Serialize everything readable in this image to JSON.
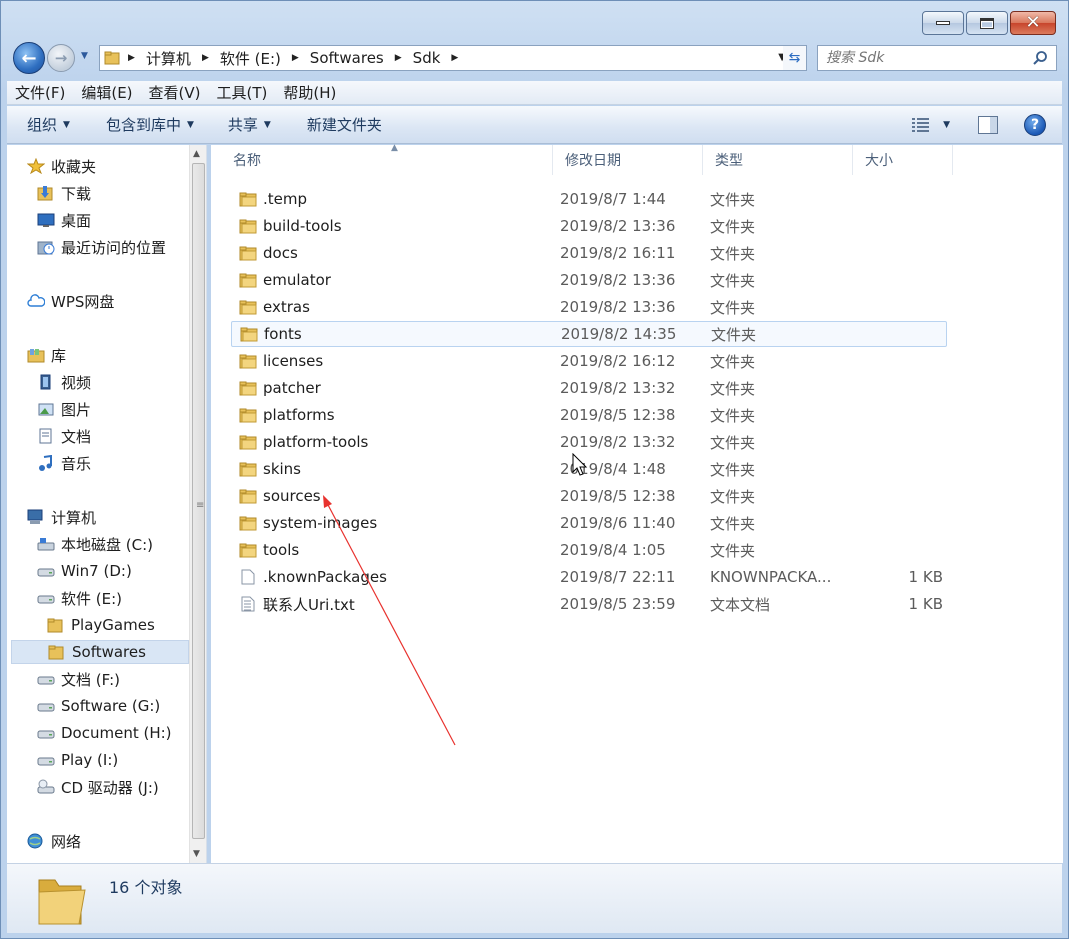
{
  "address": {
    "crumbs": [
      "计算机",
      "软件 (E:)",
      "Softwares",
      "Sdk"
    ]
  },
  "search": {
    "placeholder": "搜索 Sdk"
  },
  "menu": [
    "文件(F)",
    "编辑(E)",
    "查看(V)",
    "工具(T)",
    "帮助(H)"
  ],
  "commands": [
    {
      "label": "组织",
      "dropdown": true
    },
    {
      "label": "包含到库中",
      "dropdown": true
    },
    {
      "label": "共享",
      "dropdown": true
    },
    {
      "label": "新建文件夹",
      "dropdown": false
    }
  ],
  "nav": [
    {
      "label": "收藏夹",
      "icon": "star-icon",
      "indent": 0
    },
    {
      "label": "下载",
      "icon": "download-folder-icon",
      "indent": 1
    },
    {
      "label": "桌面",
      "icon": "desktop-icon",
      "indent": 1
    },
    {
      "label": "最近访问的位置",
      "icon": "recent-places-icon",
      "indent": 1
    },
    {
      "label": "WPS网盘",
      "icon": "cloud-icon",
      "indent": 0
    },
    {
      "label": "库",
      "icon": "library-icon",
      "indent": 0
    },
    {
      "label": "视频",
      "icon": "video-library-icon",
      "indent": 1
    },
    {
      "label": "图片",
      "icon": "pictures-library-icon",
      "indent": 1
    },
    {
      "label": "文档",
      "icon": "documents-library-icon",
      "indent": 1
    },
    {
      "label": "音乐",
      "icon": "music-library-icon",
      "indent": 1
    },
    {
      "label": "计算机",
      "icon": "computer-icon",
      "indent": 0
    },
    {
      "label": "本地磁盘 (C:)",
      "icon": "system-drive-icon",
      "indent": 1
    },
    {
      "label": "Win7 (D:)",
      "icon": "drive-icon",
      "indent": 1
    },
    {
      "label": "软件 (E:)",
      "icon": "drive-icon",
      "indent": 1
    },
    {
      "label": "PlayGames",
      "icon": "folder-icon",
      "indent": 2
    },
    {
      "label": "Softwares",
      "icon": "folder-icon",
      "indent": 2,
      "selected": true
    },
    {
      "label": "文档 (F:)",
      "icon": "drive-icon",
      "indent": 1
    },
    {
      "label": "Software (G:)",
      "icon": "drive-icon",
      "indent": 1
    },
    {
      "label": "Document (H:)",
      "icon": "drive-icon",
      "indent": 1
    },
    {
      "label": "Play (I:)",
      "icon": "drive-icon",
      "indent": 1
    },
    {
      "label": "CD 驱动器 (J:)",
      "icon": "cd-drive-icon",
      "indent": 1
    },
    {
      "label": "网络",
      "icon": "network-icon",
      "indent": 0
    }
  ],
  "columns": [
    "名称",
    "修改日期",
    "类型",
    "大小"
  ],
  "files": [
    {
      "name": ".temp",
      "date": "2019/8/7 1:44",
      "type": "文件夹",
      "size": "",
      "kind": "folder"
    },
    {
      "name": "build-tools",
      "date": "2019/8/2 13:36",
      "type": "文件夹",
      "size": "",
      "kind": "folder"
    },
    {
      "name": "docs",
      "date": "2019/8/2 16:11",
      "type": "文件夹",
      "size": "",
      "kind": "folder"
    },
    {
      "name": "emulator",
      "date": "2019/8/2 13:36",
      "type": "文件夹",
      "size": "",
      "kind": "folder"
    },
    {
      "name": "extras",
      "date": "2019/8/2 13:36",
      "type": "文件夹",
      "size": "",
      "kind": "folder"
    },
    {
      "name": "fonts",
      "date": "2019/8/2 14:35",
      "type": "文件夹",
      "size": "",
      "kind": "folder",
      "hover": true
    },
    {
      "name": "licenses",
      "date": "2019/8/2 16:12",
      "type": "文件夹",
      "size": "",
      "kind": "folder"
    },
    {
      "name": "patcher",
      "date": "2019/8/2 13:32",
      "type": "文件夹",
      "size": "",
      "kind": "folder"
    },
    {
      "name": "platforms",
      "date": "2019/8/5 12:38",
      "type": "文件夹",
      "size": "",
      "kind": "folder"
    },
    {
      "name": "platform-tools",
      "date": "2019/8/2 13:32",
      "type": "文件夹",
      "size": "",
      "kind": "folder"
    },
    {
      "name": "skins",
      "date": "2019/8/4 1:48",
      "type": "文件夹",
      "size": "",
      "kind": "folder"
    },
    {
      "name": "sources",
      "date": "2019/8/5 12:38",
      "type": "文件夹",
      "size": "",
      "kind": "folder"
    },
    {
      "name": "system-images",
      "date": "2019/8/6 11:40",
      "type": "文件夹",
      "size": "",
      "kind": "folder"
    },
    {
      "name": "tools",
      "date": "2019/8/4 1:05",
      "type": "文件夹",
      "size": "",
      "kind": "folder"
    },
    {
      "name": ".knownPackages",
      "date": "2019/8/7 22:11",
      "type": "KNOWNPACKA...",
      "size": "1 KB",
      "kind": "file"
    },
    {
      "name": "联系人Uri.txt",
      "date": "2019/8/5 23:59",
      "type": "文本文档",
      "size": "1 KB",
      "kind": "text"
    }
  ],
  "status": {
    "count_text": "16 个对象"
  },
  "colors": {
    "accent": "#3a6ea8",
    "annotation": "#e8322e",
    "folder": "#e8c15a"
  }
}
